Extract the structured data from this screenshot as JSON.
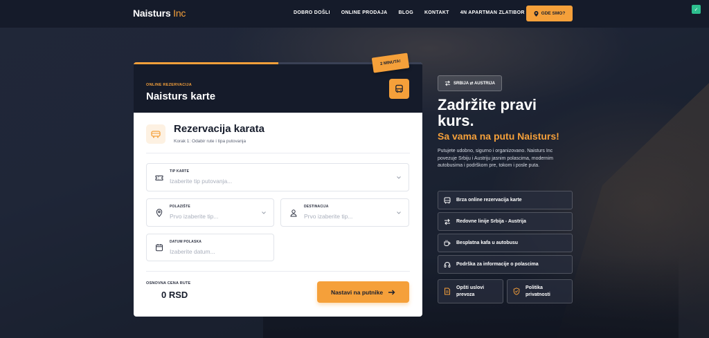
{
  "nav": {
    "logo_main": "Naisturs",
    "logo_inc": "Inc",
    "items": [
      "DOBRO DOŠLI",
      "ONLINE PRODAJA",
      "BLOG",
      "KONTAKT",
      "4N APARTMAN ZLATIBOR"
    ],
    "cta": "GDE SMO?",
    "extension_icon": "extension-icon"
  },
  "card": {
    "kicker": "ONLINE REZERVACIJA",
    "title": "Naisturs karte",
    "badge": "2 MINUTA!",
    "progress": 0.5,
    "section_title": "Rezervacija karata",
    "section_sub": "Korak 1: Odabir rute i tipa putovanja",
    "ticket_type": {
      "label": "TIP KARTE",
      "placeholder": "Izaberite tip putovanja..."
    },
    "departure": {
      "label": "POLAZIŠTE",
      "placeholder": "Prvo izaberite tip..."
    },
    "destination": {
      "label": "DESTINACIJA",
      "placeholder": "Prvo izaberite tip..."
    },
    "date": {
      "label": "DATUM POLASKA",
      "placeholder": "Izaberite datum..."
    },
    "price_label": "OSNOVNA CENA RUTE",
    "price_value": "0 RSD",
    "next_button": "Nastavi na putnike"
  },
  "hero": {
    "route_pill": "SRBIJA ⇄ AUSTRIJA",
    "title_line1": "Zadržite pravi",
    "title_line2": "kurs.",
    "subtitle": "Sa vama na putu Naisturs!",
    "description": "Putujete udobno, sigurno i organizovano. Naisturs Inc povezuje Srbiju i Austriju jasnim polascima, modernim autobusima i podrškom pre, tokom i posle puta.",
    "features": [
      "Brza online rezervacija karte",
      "Redovne linije Srbija - Austrija",
      "Besplatna kafa u autobusu",
      "Podrška za informacije o polascima"
    ],
    "terms_line1": "Opšti uslovi",
    "terms_line2": "prevoza",
    "privacy_line1": "Politika",
    "privacy_line2": "privatnosti"
  },
  "colors": {
    "accent": "#f5a03a",
    "dark": "#151b2a"
  }
}
